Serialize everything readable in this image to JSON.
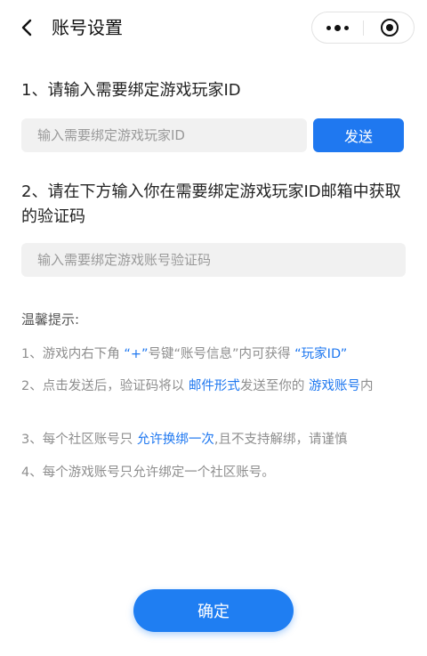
{
  "nav": {
    "title": "账号设置",
    "back_icon": "chevron-left-icon",
    "more_icon": "more-dots-icon",
    "close_icon": "target-circle-icon"
  },
  "step1": {
    "title": "1、请输入需要绑定游戏玩家ID",
    "input_placeholder": "输入需要绑定游戏玩家ID",
    "input_value": "",
    "send_label": "发送"
  },
  "step2": {
    "title": "2、请在下方输入你在需要绑定游戏玩家ID邮箱中获取的验证码",
    "input_placeholder": "输入需要绑定游戏账号验证码",
    "input_value": ""
  },
  "tips": {
    "title": "温馨提示:",
    "items": [
      [
        {
          "text": "1、游戏内右下角 ",
          "hl": false
        },
        {
          "text": "“+”",
          "hl": true
        },
        {
          "text": "号键“账号信息”内可获得 ",
          "hl": false
        },
        {
          "text": "“玩家ID”",
          "hl": true
        }
      ],
      [
        {
          "text": "2、点击发送后，验证码将以 ",
          "hl": false
        },
        {
          "text": "邮件形式",
          "hl": true
        },
        {
          "text": "发送至你的 ",
          "hl": false
        },
        {
          "text": "游戏账号",
          "hl": true
        },
        {
          "text": "内",
          "hl": false
        }
      ],
      [
        {
          "text": "3、每个社区账号只 ",
          "hl": false
        },
        {
          "text": "允许换绑一次",
          "hl": true
        },
        {
          "text": ",且不支持解绑，请谨慎",
          "hl": false
        }
      ],
      [
        {
          "text": "4、每个游戏账号只允许绑定一个社区账号。",
          "hl": false
        }
      ]
    ]
  },
  "confirm_label": "确定",
  "colors": {
    "accent": "#1f78f0",
    "input_bg": "#f1f1f1",
    "tip_text": "#8e8e8e"
  }
}
